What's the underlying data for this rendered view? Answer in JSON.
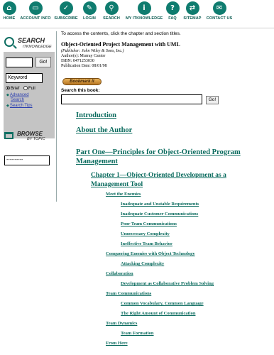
{
  "nav": [
    {
      "label": "HOME",
      "glyph": "⌂",
      "icon": "home-icon"
    },
    {
      "label": "ACCOUNT INFO",
      "glyph": "▭",
      "icon": "account-icon"
    },
    {
      "label": "SUBSCRIBE",
      "glyph": "✓",
      "icon": "subscribe-icon"
    },
    {
      "label": "LOGIN",
      "glyph": "✎",
      "icon": "login-icon"
    },
    {
      "label": "SEARCH",
      "glyph": "⚲",
      "icon": "search-icon"
    },
    {
      "label": "MY ITKNOWLEDGE",
      "glyph": "i",
      "icon": "my-itknowledge-icon"
    },
    {
      "label": "FAQ",
      "glyph": "?",
      "icon": "faq-icon"
    },
    {
      "label": "SITEMAP",
      "glyph": "⇄",
      "icon": "sitemap-icon"
    },
    {
      "label": "CONTACT US",
      "glyph": "✉",
      "icon": "contact-icon"
    }
  ],
  "sidebar": {
    "search_title": "SEARCH",
    "search_subtitle": "ITKNOWLEDGE",
    "search_input_value": "",
    "go_label": "Go!",
    "select_value": "Keyword",
    "radio_brief": "Brief",
    "radio_full": "Full",
    "advanced_line1": "Advanced",
    "advanced_line2": "Search",
    "search_tips": "Search Tips",
    "browse_title": "BROWSE",
    "browse_subtitle": "BY TOPIC",
    "topic_select_value": "----------"
  },
  "book": {
    "intro": "To access the contents, click the chapter and section titles.",
    "title": "Object-Oriented Project Management with UML",
    "publisher": "(Publisher: John Wiley & Sons, Inc.)",
    "authors": "Author(s): Murray Cantor",
    "isbn": "ISBN: 0471253030",
    "pub_date": "Publication Date: 08/01/98",
    "bookmark_label": "Bookmark It",
    "search_label": "Search this book:",
    "search_value": "",
    "go_label": "Go!"
  },
  "toc": {
    "introduction": "Introduction",
    "about_author": "About the Author",
    "part1_line1": "Part One—Principles for Object-Oriented Program",
    "part1_line2": "Management",
    "ch1_line1": "Chapter 1—Object-Oriented Development as a",
    "ch1_line2": "Management Tool",
    "meet_enemies": "Meet the Enemies",
    "inadequate_reqs": "Inadequate and Unstable Requirements",
    "inadequate_comms": "Inadequate Customer Communications",
    "poor_team_comms": "Poor Team Communications",
    "unnecessary_complexity": "Unnecessary Complexity",
    "ineffective_team": "Ineffective Team Behavior",
    "conquering": "Conquering Enemies with Object Technology",
    "attacking_complexity": "Attacking Complexity",
    "collaboration": "Collaboration",
    "dev_collab": "Development as Collaborative Problem Solving",
    "team_comms": "Team Communications",
    "common_vocab": "Common Vocabulary, Common Language",
    "right_amount": "The Right Amount of Communication",
    "team_dynamics": "Team Dynamics",
    "team_formation": "Team Formation",
    "from_here": "From Here"
  }
}
